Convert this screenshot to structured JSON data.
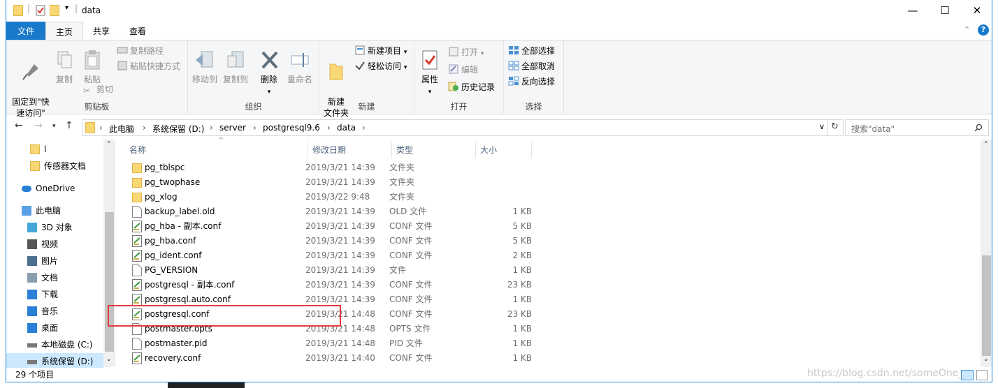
{
  "window": {
    "title": "data",
    "minimize": "—",
    "maximize": "☐",
    "close": "✕"
  },
  "ribbon_tabs": [
    "文件",
    "主页",
    "共享",
    "查看"
  ],
  "ribbon": {
    "clipboard": {
      "label": "剪贴板",
      "pin": "固定到\"快\n速访问\"",
      "copy": "复制",
      "paste": "粘贴",
      "copy_path": "复制路径",
      "paste_shortcut": "粘贴快捷方式",
      "cut": "剪切"
    },
    "organize": {
      "label": "组织",
      "move_to": "移动到",
      "copy_to": "复制到",
      "delete": "删除",
      "rename": "重命名"
    },
    "new": {
      "label": "新建",
      "new_folder": "新建\n文件夹",
      "new_item": "新建项目",
      "easy_access": "轻松访问"
    },
    "open": {
      "label": "打开",
      "properties": "属性",
      "open": "打开",
      "edit": "编辑",
      "history": "历史记录"
    },
    "select": {
      "label": "选择",
      "select_all": "全部选择",
      "select_none": "全部取消",
      "invert": "反向选择"
    }
  },
  "address": {
    "crumbs": [
      "此电脑",
      "系统保留 (D:)",
      "server",
      "postgresql9.6",
      "data"
    ],
    "search_placeholder": "搜索\"data\""
  },
  "nav": [
    {
      "label": "l",
      "icon": "folder-icon"
    },
    {
      "label": "传感器文档",
      "icon": "folder-icon"
    },
    {
      "label": "OneDrive",
      "icon": "cloud-icon"
    },
    {
      "label": "此电脑",
      "icon": "computer-icon"
    },
    {
      "label": "3D 对象",
      "icon": "cube-icon"
    },
    {
      "label": "视频",
      "icon": "video-icon"
    },
    {
      "label": "图片",
      "icon": "picture-icon"
    },
    {
      "label": "文档",
      "icon": "document-icon"
    },
    {
      "label": "下载",
      "icon": "download-icon"
    },
    {
      "label": "音乐",
      "icon": "music-icon"
    },
    {
      "label": "桌面",
      "icon": "desktop-icon"
    },
    {
      "label": "本地磁盘 (C:)",
      "icon": "drive-icon"
    },
    {
      "label": "系统保留 (D:)",
      "icon": "drive-icon"
    }
  ],
  "columns": {
    "name": "名称",
    "date": "修改日期",
    "type": "类型",
    "size": "大小"
  },
  "files": [
    {
      "name": "pg_tblspc",
      "date": "2019/3/21 14:39",
      "type": "文件夹",
      "size": "",
      "kind": "folder"
    },
    {
      "name": "pg_twophase",
      "date": "2019/3/21 14:39",
      "type": "文件夹",
      "size": "",
      "kind": "folder"
    },
    {
      "name": "pg_xlog",
      "date": "2019/3/22 9:48",
      "type": "文件夹",
      "size": "",
      "kind": "folder"
    },
    {
      "name": "backup_label.old",
      "date": "2019/3/21 14:39",
      "type": "OLD 文件",
      "size": "1 KB",
      "kind": "file"
    },
    {
      "name": "pg_hba - 副本.conf",
      "date": "2019/3/21 14:39",
      "type": "CONF 文件",
      "size": "5 KB",
      "kind": "conf"
    },
    {
      "name": "pg_hba.conf",
      "date": "2019/3/21 14:39",
      "type": "CONF 文件",
      "size": "5 KB",
      "kind": "conf"
    },
    {
      "name": "pg_ident.conf",
      "date": "2019/3/21 14:39",
      "type": "CONF 文件",
      "size": "2 KB",
      "kind": "conf"
    },
    {
      "name": "PG_VERSION",
      "date": "2019/3/21 14:39",
      "type": "文件",
      "size": "1 KB",
      "kind": "file"
    },
    {
      "name": "postgresql - 副本.conf",
      "date": "2019/3/21 14:39",
      "type": "CONF 文件",
      "size": "23 KB",
      "kind": "conf"
    },
    {
      "name": "postgresql.auto.conf",
      "date": "2019/3/21 14:39",
      "type": "CONF 文件",
      "size": "1 KB",
      "kind": "conf"
    },
    {
      "name": "postgresql.conf",
      "date": "2019/3/21 14:48",
      "type": "CONF 文件",
      "size": "23 KB",
      "kind": "conf"
    },
    {
      "name": "postmaster.opts",
      "date": "2019/3/21 14:48",
      "type": "OPTS 文件",
      "size": "1 KB",
      "kind": "file"
    },
    {
      "name": "postmaster.pid",
      "date": "2019/3/21 14:48",
      "type": "PID 文件",
      "size": "1 KB",
      "kind": "file"
    },
    {
      "name": "recovery.conf",
      "date": "2019/3/21 14:40",
      "type": "CONF 文件",
      "size": "1 KB",
      "kind": "conf"
    }
  ],
  "status": {
    "count": "29 个项目"
  },
  "watermark": "https://blog.csdn.net/someOne_"
}
